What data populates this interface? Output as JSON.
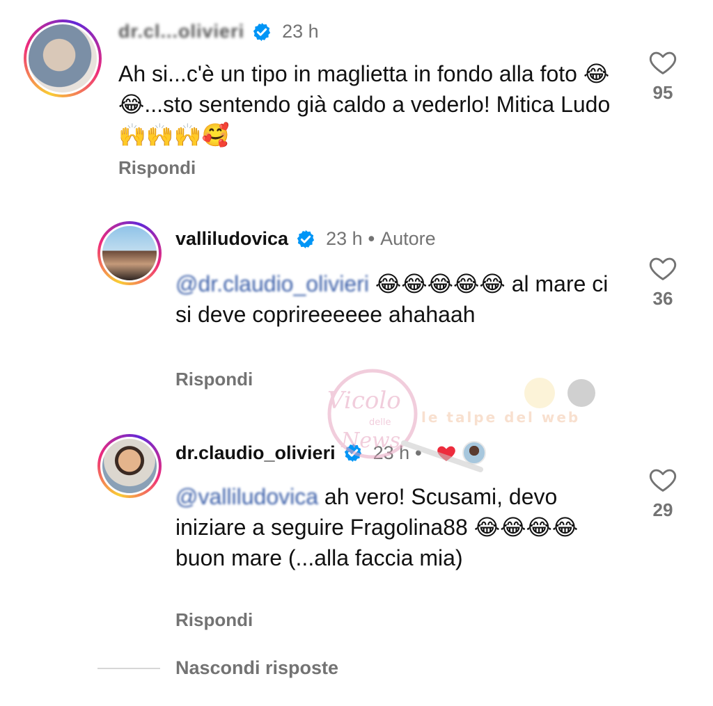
{
  "comments": [
    {
      "username": "dr.cl...olivieri",
      "time": "23 h",
      "text": "Ah si...c'è un tipo in maglietta in fondo alla foto 😂😂...sto sentendo già caldo a vederlo! Mitica Ludo 🙌🙌🙌🥰",
      "reply_label": "Rispondi",
      "likes": "95"
    },
    {
      "username": "valliludovica",
      "time": "23 h",
      "badge": "Autore",
      "mention": "@dr.claudio_olivieri",
      "text": " 😂😂😂😂😂 al mare ci si deve coprireeeeee ahahaah",
      "reply_label": "Rispondi",
      "likes": "36"
    },
    {
      "username": "dr.claudio_olivieri",
      "time": "23 h",
      "mention": "@valliludovica",
      "text": " ah vero! Scusami, devo iniziare a seguire Fragolina88 😂😂😂😂 buon mare (...alla faccia mia)",
      "reply_label": "Rispondi",
      "likes": "29"
    }
  ],
  "hide_replies_label": "Nascondi risposte",
  "watermark": {
    "line1": "Vicolo",
    "line2": "delle",
    "line3": "News",
    "line4": "le talpe del web"
  },
  "colors": {
    "verified": "#0095f6",
    "secondary_text": "#737373",
    "like_heart": "#ed2c3d"
  }
}
